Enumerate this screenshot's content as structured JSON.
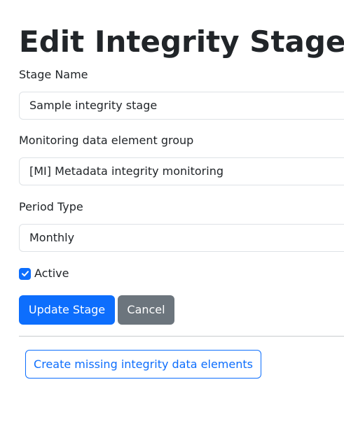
{
  "page": {
    "title": "Edit Integrity Stage"
  },
  "form": {
    "stage_name": {
      "label": "Stage Name",
      "value": "Sample integrity stage"
    },
    "monitoring_group": {
      "label": "Monitoring data element group",
      "value": "[MI] Metadata integrity monitoring"
    },
    "period_type": {
      "label": "Period Type",
      "value": "Monthly"
    },
    "active": {
      "label": "Active",
      "checked": true
    }
  },
  "actions": {
    "update_label": "Update Stage",
    "cancel_label": "Cancel",
    "create_missing_label": "Create missing integrity data elements"
  },
  "colors": {
    "primary": "#0d6efd",
    "secondary": "#6c757d",
    "text": "#212529",
    "border": "#dee2e6"
  }
}
